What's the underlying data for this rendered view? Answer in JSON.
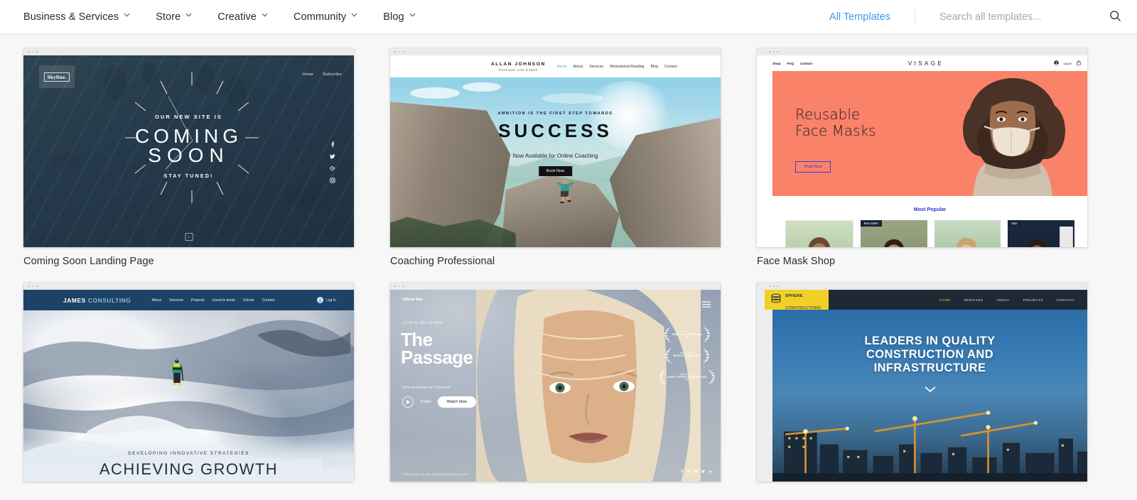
{
  "nav": {
    "items": [
      {
        "label": "Business & Services",
        "icon": "chevron-down-icon"
      },
      {
        "label": "Store",
        "icon": "chevron-down-icon"
      },
      {
        "label": "Creative",
        "icon": "chevron-down-icon"
      },
      {
        "label": "Community",
        "icon": "chevron-down-icon"
      },
      {
        "label": "Blog",
        "icon": "chevron-down-icon"
      }
    ],
    "all_templates": "All Templates",
    "all_templates_color": "#3899ec",
    "search_placeholder": "Search all templates...",
    "search_value": "",
    "search_icon": "search-icon"
  },
  "cards": [
    {
      "title": "Coming Soon Landing Page"
    },
    {
      "title": "Coaching Professional"
    },
    {
      "title": "Face Mask Shop"
    },
    {
      "title": ""
    },
    {
      "title": ""
    },
    {
      "title": ""
    }
  ],
  "t1": {
    "logo": "Skyline.",
    "nav": [
      "Home",
      "Subscribe"
    ],
    "kicker": "OUR NEW SITE IS",
    "title_line1": "COMING",
    "title_line2": "SOON",
    "sub": "STAY TUNED!",
    "social": [
      "facebook-icon",
      "twitter-icon",
      "google-plus-icon",
      "instagram-icon"
    ],
    "bg": "#24394a"
  },
  "t2": {
    "brand": "ALLAN JOHNSON",
    "brand_sub": "Personal Life Coach",
    "nav": [
      "Home",
      "About",
      "Services",
      "Motivational Reading",
      "Blog",
      "Contact"
    ],
    "active_nav": "Home",
    "kicker": "AMBITION IS THE FIRST STEP TOWARDS",
    "title": "SUCCESS",
    "sub": "Now Available for Online Coaching",
    "button": "Book Now"
  },
  "t3": {
    "nav_left": [
      "Shop",
      "FAQ",
      "Contact"
    ],
    "logo": "VISAGE",
    "login": "Log in",
    "icons": [
      "account-icon",
      "cart-icon"
    ],
    "h1_line1": "Reusable",
    "h1_line2": "Face Masks",
    "button": "Shop Now",
    "section_title": "Most Popular",
    "accent": "#f98268",
    "link_color": "#3b3bcf",
    "products": [
      {
        "tag": ""
      },
      {
        "tag": "Best Seller"
      },
      {
        "tag": ""
      },
      {
        "tag": "Sale"
      }
    ]
  },
  "t4": {
    "brand_bold": "JAMES ",
    "brand_light": "CONSULTING",
    "nav": [
      "About",
      "Services",
      "Projects",
      "Good to know",
      "Clients",
      "Contact"
    ],
    "login": "Log In",
    "login_icon": "account-circle-icon",
    "kicker": "DEVELOPING INNOVATIVE STRATEGIES",
    "h1": "ACHIEVING GROWTH",
    "navbar_color": "#1d4268"
  },
  "t5": {
    "official": "Official Site",
    "menu_icon": "hamburger-menu-icon",
    "by": "A Film by Alice de Silva",
    "title_line1": "The",
    "title_line2": "Passage",
    "avail": "Now Available on Demand",
    "trailer": "Trailer",
    "trailer_icon": "play-icon",
    "watch": "Watch Now",
    "awards": [
      {
        "top": "Best Film",
        "name": "INDIE FILM FESTIVAL",
        "year": "2023"
      },
      {
        "top": "Official Selection",
        "name": "BOSTON CINEFEST",
        "year": "2023"
      },
      {
        "top": "Official Selection",
        "name": "SAINT-TROPEZ FILM FESTIVAL",
        "year": "2023"
      }
    ],
    "footer": "©2023 by Alice de Silva. Proudly created with Wix.com",
    "social": [
      "facebook-icon",
      "instagram-icon",
      "youtube-icon",
      "twitter-icon",
      "vimeo-icon"
    ]
  },
  "t6": {
    "logo_line1": "SPHERE",
    "logo_line2": "CONSTRUCTIONS",
    "logo_icon": "sphere-logo-icon",
    "nav": [
      "HOME",
      "SERVICES",
      "ABOUT",
      "PROJECTS",
      "CONTACT"
    ],
    "active_nav": "HOME",
    "h1_line1": "LEADERS IN QUALITY",
    "h1_line2": "CONSTRUCTION AND",
    "h1_line3": "INFRASTRUCTURE",
    "chevron_icon": "chevron-down-icon",
    "accent": "#f2d029",
    "navbar_color": "#1d2a35"
  }
}
